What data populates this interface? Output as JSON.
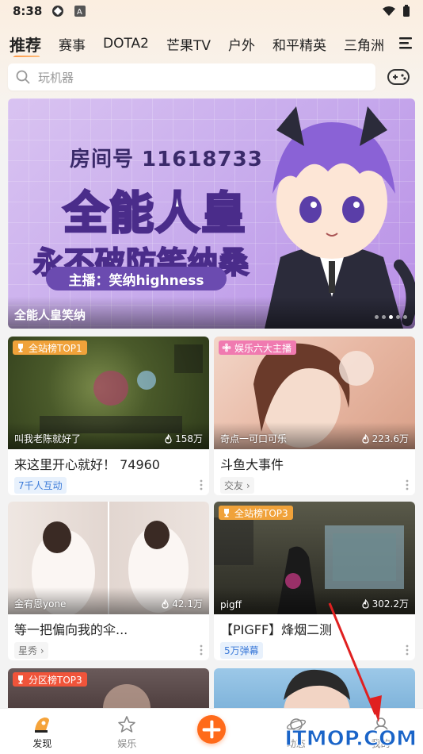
{
  "status_bar": {
    "time": "8:38"
  },
  "tabs": [
    "推荐",
    "赛事",
    "DOTA2",
    "芒果TV",
    "户外",
    "和平精英",
    "三角洲"
  ],
  "search": {
    "placeholder": "玩机器"
  },
  "banner": {
    "room_text": "房间号 11618733",
    "headline": "全能人皇",
    "subline": "永不破防笑纳桑",
    "host_label": "主播：笑纳highness",
    "caption": "全能人皇笑纳",
    "dots": 5,
    "active_dot": 3
  },
  "cards": [
    {
      "badge": "全站榜TOP1",
      "badge_color": "#f0a23a",
      "streamer": "叫我老陈就好了",
      "viewers": "158万",
      "title": "来这里开心就好！ 74960",
      "tag": "7千人互动",
      "tag_style": "blue"
    },
    {
      "badge": "娱乐六大主播",
      "badge_color": "#f07ab0",
      "streamer": "奇点一可口可乐",
      "viewers": "223.6万",
      "title": "斗鱼大事件",
      "tag": "交友 ›",
      "tag_style": "gray"
    },
    {
      "badge": "",
      "badge_color": "",
      "streamer": "金宥恩yone",
      "viewers": "42.1万",
      "title": "等一把偏向我的伞...",
      "tag": "星秀 ›",
      "tag_style": "gray"
    },
    {
      "badge": "全站榜TOP3",
      "badge_color": "#f0a23a",
      "streamer": "pigff",
      "viewers": "302.2万",
      "title": "【PIGFF】烽烟二测",
      "tag": "5万弹幕",
      "tag_style": "blue"
    },
    {
      "badge": "分区榜TOP3",
      "badge_color": "#f0543a",
      "streamer": "",
      "viewers": "",
      "title": "",
      "tag": "",
      "tag_style": "gray"
    },
    {
      "badge": "",
      "badge_color": "",
      "streamer": "",
      "viewers": "",
      "title": "",
      "tag": "",
      "tag_style": "gray"
    }
  ],
  "bottom_nav": [
    {
      "label": "发现",
      "icon": "discover-icon",
      "active": true
    },
    {
      "label": "娱乐",
      "icon": "star-icon",
      "active": false
    },
    {
      "label": "",
      "icon": "plus-icon",
      "active": false
    },
    {
      "label": "动态",
      "icon": "planet-icon",
      "active": false
    },
    {
      "label": "我的",
      "icon": "profile-icon",
      "active": false
    }
  ],
  "watermark": "ITMOP.COM",
  "colors": {
    "accent": "#ff6a1a",
    "blue_tag": "#3d7bd9"
  }
}
